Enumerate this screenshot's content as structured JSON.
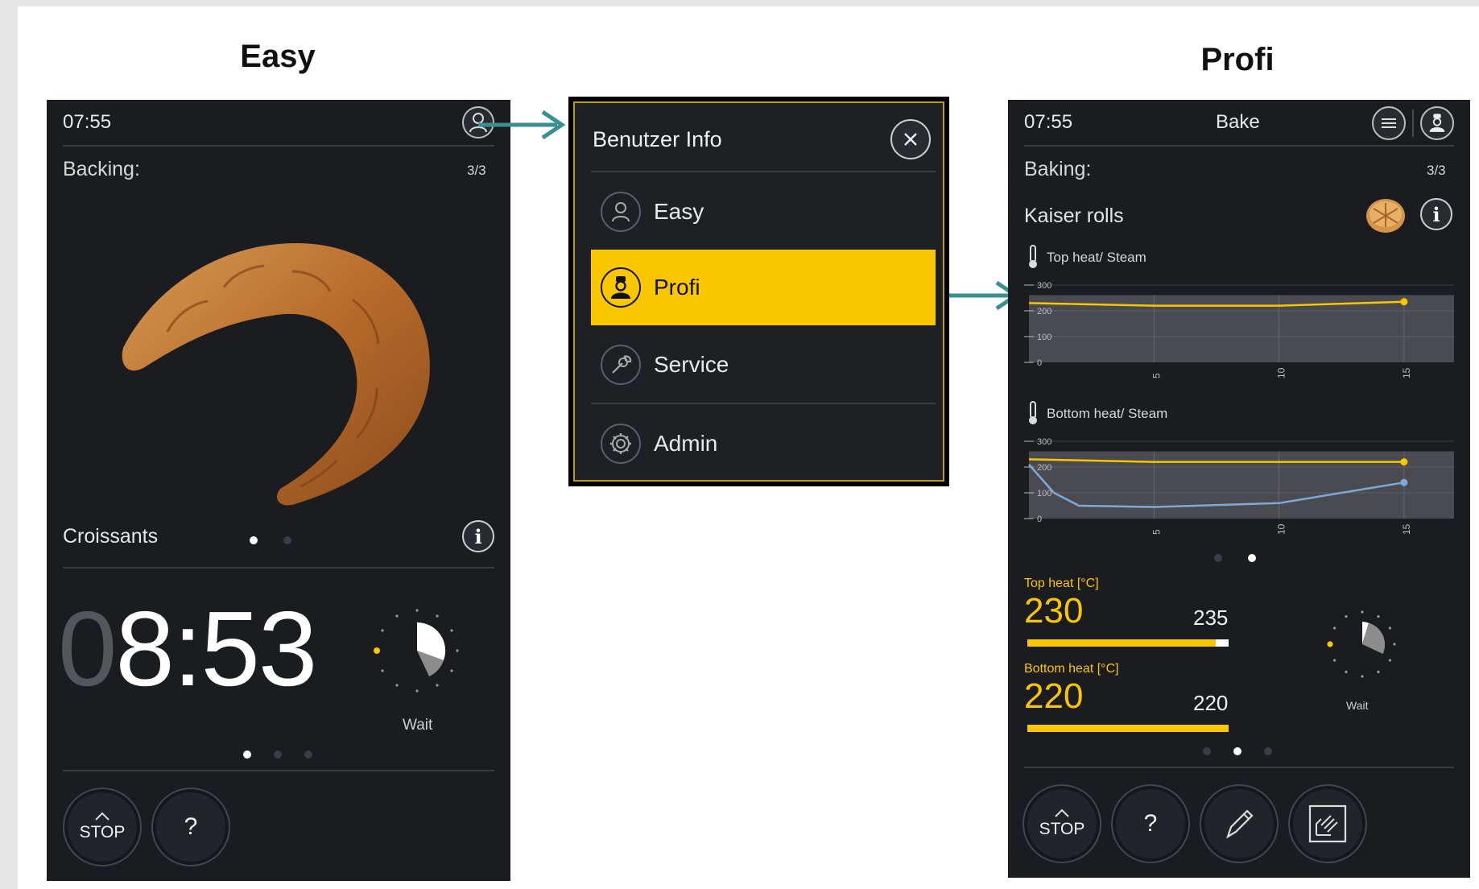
{
  "easy": {
    "heading": "Easy",
    "time": "07:55",
    "program_label": "Backing:",
    "step": "3/3",
    "product_name": "Croissants",
    "timer_dim": "0",
    "timer_main": "8:53",
    "wait_label": "Wait",
    "stop_label": "STOP",
    "help_label": "?"
  },
  "menu": {
    "title": "Benutzer Info",
    "items": [
      {
        "label": "Easy",
        "icon": "user-icon",
        "active": false
      },
      {
        "label": "Profi",
        "icon": "chef-icon",
        "active": true
      },
      {
        "label": "Service",
        "icon": "wrench-icon",
        "active": false
      },
      {
        "label": "Admin",
        "icon": "gear-icon",
        "active": false
      }
    ]
  },
  "profi": {
    "heading": "Profi",
    "time": "07:55",
    "title": "Bake",
    "program_label": "Baking:",
    "step": "3/3",
    "product_name": "Kaiser rolls",
    "chart_top_label": "Top heat/ Steam",
    "chart_bottom_label": "Bottom heat/ Steam",
    "top_heat_label": "Top heat [°C]",
    "top_heat_value": "230",
    "top_heat_target": "235",
    "bottom_heat_label": "Bottom heat [°C]",
    "bottom_heat_value": "220",
    "bottom_heat_target": "220",
    "wait_label": "Wait",
    "stop_label": "STOP",
    "help_label": "?"
  },
  "colors": {
    "accent": "#f9c600",
    "teal": "#3a8f93",
    "panel": "#1b1c20",
    "steam": "#7fa9d6"
  },
  "chart_data": [
    {
      "type": "line",
      "title": "Top heat/ Steam",
      "x_ticks": [
        5,
        10,
        15
      ],
      "y_ticks": [
        0,
        100,
        200,
        300
      ],
      "xlim": [
        0,
        17
      ],
      "ylim": [
        0,
        300
      ],
      "series": [
        {
          "x": [
            0,
            5,
            10,
            15
          ],
          "y": [
            230,
            220,
            220,
            235
          ]
        }
      ]
    },
    {
      "type": "line",
      "title": "Bottom heat/ Steam",
      "x_ticks": [
        5,
        10,
        15
      ],
      "y_ticks": [
        0,
        100,
        200,
        300
      ],
      "xlim": [
        0,
        17
      ],
      "ylim": [
        0,
        300
      ],
      "series": [
        {
          "x": [
            0,
            5,
            10,
            15
          ],
          "y": [
            230,
            220,
            220,
            220
          ]
        },
        {
          "x": [
            0,
            1,
            2,
            5,
            10,
            15
          ],
          "y": [
            210,
            100,
            50,
            45,
            60,
            140
          ]
        }
      ]
    }
  ]
}
